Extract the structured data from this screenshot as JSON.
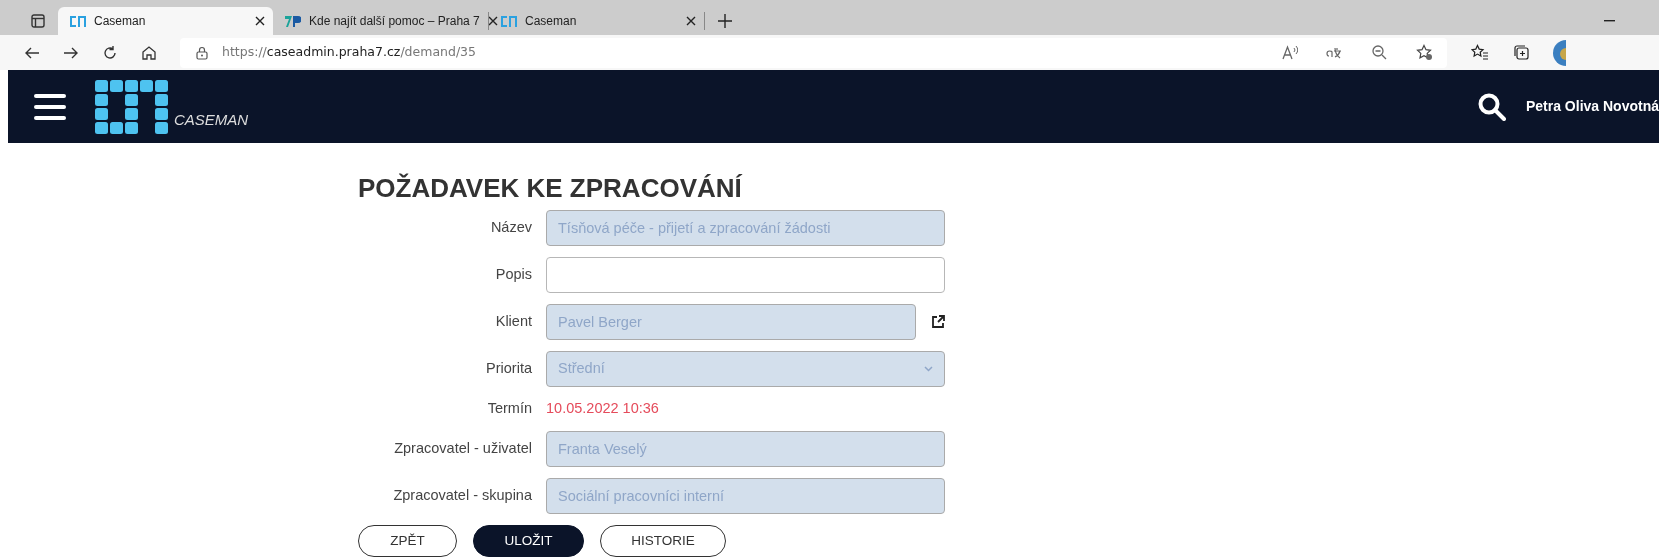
{
  "browser": {
    "tabs": [
      {
        "title": "Caseman",
        "kind": "caseman",
        "selected": true
      },
      {
        "title": "Kde najít další pomoc – Praha 7",
        "kind": "praha7",
        "selected": false
      },
      {
        "title": "Caseman",
        "kind": "caseman",
        "selected": false
      }
    ],
    "address": {
      "scheme": "https://",
      "host": "caseadmin.praha7.cz",
      "path": "/demand/35"
    }
  },
  "header": {
    "app_name": "CASEMAN",
    "user": "Petra Oliva Novotná"
  },
  "form": {
    "title": "POŽADAVEK KE ZPRACOVÁNÍ",
    "fields": [
      {
        "label": "Název",
        "kind": "text",
        "value": "Tísňová péče - přijetí a zpracování žádosti",
        "disabled": true
      },
      {
        "label": "Popis",
        "kind": "text",
        "disabled": false
      },
      {
        "label": "Klient",
        "kind": "text",
        "value": "Pavel Berger",
        "disabled": true,
        "link": true
      },
      {
        "label": "Priorita",
        "kind": "select",
        "value": "Střední",
        "disabled": true
      },
      {
        "label": "Termín",
        "kind": "static",
        "value": "10.05.2022 10:36",
        "overdue": true
      },
      {
        "label": "Zpracovatel - uživatel",
        "kind": "text",
        "value": "Franta Veselý",
        "disabled": true
      },
      {
        "label": "Zpracovatel - skupina",
        "kind": "text",
        "value": "Sociální pracovníci interní",
        "disabled": true
      }
    ],
    "buttons": [
      {
        "label": "ZPĚT",
        "primary": false
      },
      {
        "label": "ULOŽIT",
        "primary": true
      },
      {
        "label": "HISTORIE",
        "primary": false
      }
    ]
  }
}
